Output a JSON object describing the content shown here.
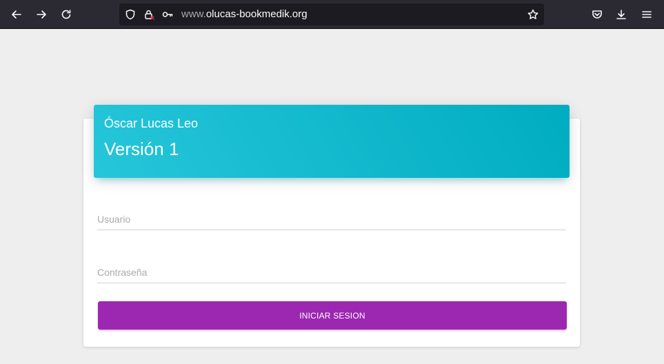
{
  "browser": {
    "url_prefix": "www.",
    "url_domain": "olucas-bookmedik.org",
    "icons": {
      "back": "back-arrow-icon",
      "forward": "forward-arrow-icon",
      "reload": "reload-icon",
      "shield": "tracking-protection-shield-icon",
      "lock": "insecure-lock-icon",
      "key": "key-icon",
      "bookmark": "star-icon",
      "pocket": "pocket-icon",
      "downloads": "download-icon",
      "menu": "hamburger-menu-icon"
    }
  },
  "login": {
    "author": "Óscar Lucas Leo",
    "version": "Versión 1",
    "username_placeholder": "Usuario",
    "password_placeholder": "Contraseña",
    "submit_label": "INICIAR SESION"
  },
  "colors": {
    "header_gradient_start": "#26c6da",
    "header_gradient_end": "#00acc1",
    "button": "#9c27b0",
    "page_background": "#eeeeee"
  }
}
